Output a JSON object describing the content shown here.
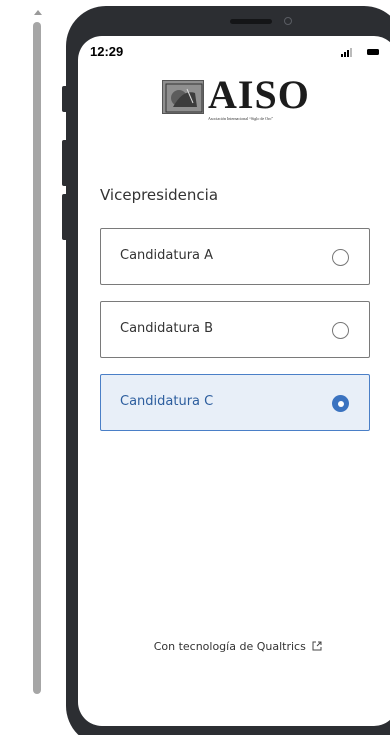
{
  "status_bar": {
    "time": "12:29"
  },
  "logo": {
    "text": "AISO",
    "subtitle": "Asociación Internacional “Siglo de Oro”"
  },
  "question": {
    "title": "Vicepresidencia",
    "choices": [
      {
        "label": "Candidatura A",
        "selected": false
      },
      {
        "label": "Candidatura B",
        "selected": false
      },
      {
        "label": "Candidatura C",
        "selected": true
      }
    ]
  },
  "navigation": {
    "back_label": "←",
    "next_label": "→"
  },
  "footer": {
    "text": "Con tecnología de Qualtrics"
  },
  "colors": {
    "accent": "#4a7fc7",
    "selected_bg": "#e8eff8",
    "back_button": "#6b6b6b",
    "phone_frame": "#2c2e32"
  },
  "icons": {
    "signal": "signal-icon",
    "battery": "battery-icon",
    "external_link": "external-link-icon"
  }
}
